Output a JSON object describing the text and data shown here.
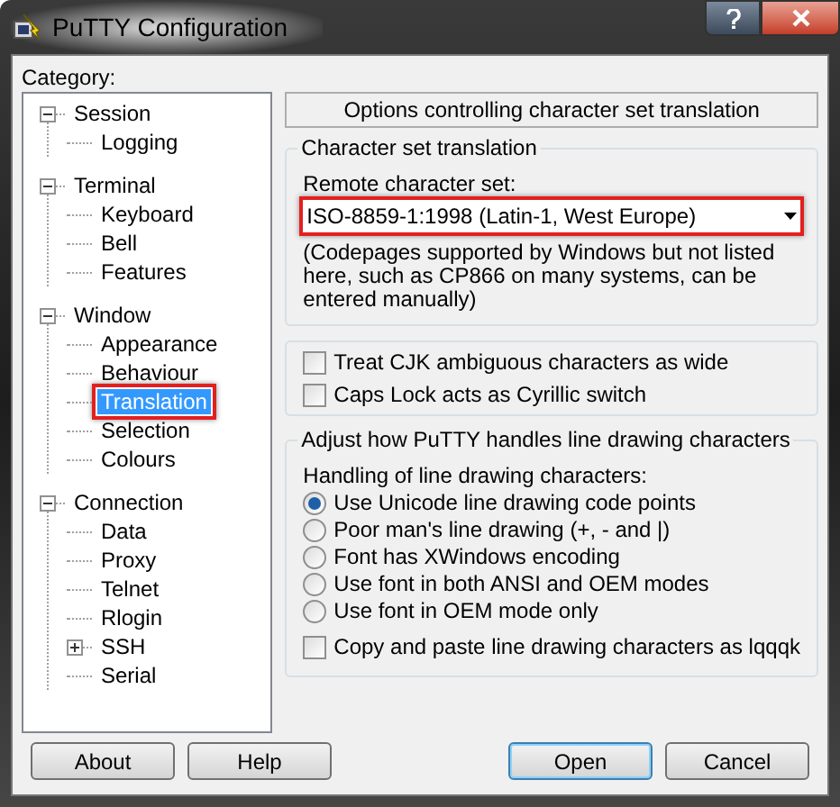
{
  "window": {
    "title": "PuTTY Configuration"
  },
  "category_label": "Category:",
  "tree": [
    {
      "label": "Session",
      "expanded": true,
      "selected": false,
      "highlighted": false,
      "children": [
        {
          "label": "Logging",
          "selected": false,
          "highlighted": false
        }
      ]
    },
    {
      "label": "Terminal",
      "expanded": true,
      "selected": false,
      "highlighted": false,
      "children": [
        {
          "label": "Keyboard",
          "selected": false,
          "highlighted": false
        },
        {
          "label": "Bell",
          "selected": false,
          "highlighted": false
        },
        {
          "label": "Features",
          "selected": false,
          "highlighted": false
        }
      ]
    },
    {
      "label": "Window",
      "expanded": true,
      "selected": false,
      "highlighted": false,
      "children": [
        {
          "label": "Appearance",
          "selected": false,
          "highlighted": false
        },
        {
          "label": "Behaviour",
          "selected": false,
          "highlighted": false
        },
        {
          "label": "Translation",
          "selected": true,
          "highlighted": true
        },
        {
          "label": "Selection",
          "selected": false,
          "highlighted": false
        },
        {
          "label": "Colours",
          "selected": false,
          "highlighted": false
        }
      ]
    },
    {
      "label": "Connection",
      "expanded": true,
      "selected": false,
      "highlighted": false,
      "children": [
        {
          "label": "Data",
          "selected": false,
          "highlighted": false
        },
        {
          "label": "Proxy",
          "selected": false,
          "highlighted": false
        },
        {
          "label": "Telnet",
          "selected": false,
          "highlighted": false
        },
        {
          "label": "Rlogin",
          "selected": false,
          "highlighted": false
        },
        {
          "label": "SSH",
          "expanded": false,
          "selected": false,
          "highlighted": false
        },
        {
          "label": "Serial",
          "selected": false,
          "highlighted": false
        }
      ]
    }
  ],
  "panel_header": "Options controlling character set translation",
  "charset_group": {
    "title": "Character set translation",
    "field_label": "Remote character set:",
    "value": "ISO-8859-1:1998 (Latin-1, West Europe)",
    "highlighted": true,
    "note": "(Codepages supported by Windows but not listed here, such as CP866 on many systems, can be entered manually)"
  },
  "options": [
    {
      "label": "Treat CJK ambiguous characters as wide",
      "checked": false
    },
    {
      "label": "Caps Lock acts as Cyrillic switch",
      "checked": false
    }
  ],
  "line_drawing_group": {
    "title": "Adjust how PuTTY handles line drawing characters",
    "subtitle": "Handling of line drawing characters:",
    "radios": [
      {
        "label": "Use Unicode line drawing code points",
        "selected": true
      },
      {
        "label": "Poor man's line drawing (+, - and |)",
        "selected": false
      },
      {
        "label": "Font has XWindows encoding",
        "selected": false
      },
      {
        "label": "Use font in both ANSI and OEM modes",
        "selected": false
      },
      {
        "label": "Use font in OEM mode only",
        "selected": false
      }
    ],
    "checkbox": {
      "label": "Copy and paste line drawing characters as lqqqk",
      "checked": false
    }
  },
  "buttons": [
    {
      "label": "About",
      "default": false
    },
    {
      "label": "Help",
      "default": false
    },
    {
      "label": "Open",
      "default": true
    },
    {
      "label": "Cancel",
      "default": false
    }
  ]
}
